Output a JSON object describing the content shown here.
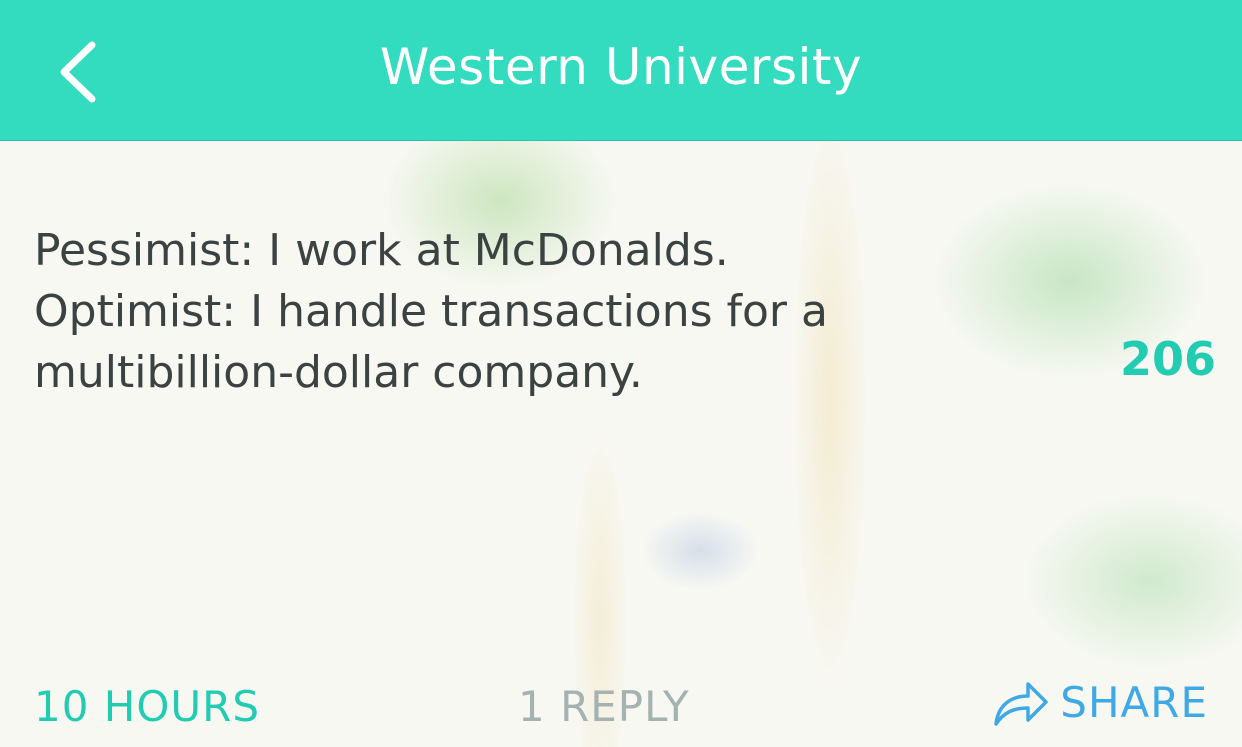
{
  "header": {
    "title": "Western University",
    "back_icon": "chevron-left-icon"
  },
  "post": {
    "lines": [
      "Pessimist: I work at McDonalds.",
      "Optimist: I handle transactions for a",
      "multibillion-dollar company."
    ],
    "votes": "206"
  },
  "footer": {
    "time": "10 HOURS",
    "replies": "1 REPLY",
    "share_label": "SHARE",
    "share_icon": "share-arrow-icon"
  },
  "colors": {
    "header_bg": "#33dbbf",
    "accent_green": "#22ccb0",
    "reply_gray": "#a4b3b1",
    "share_blue": "#3fa9e6",
    "text": "#3b4242"
  }
}
